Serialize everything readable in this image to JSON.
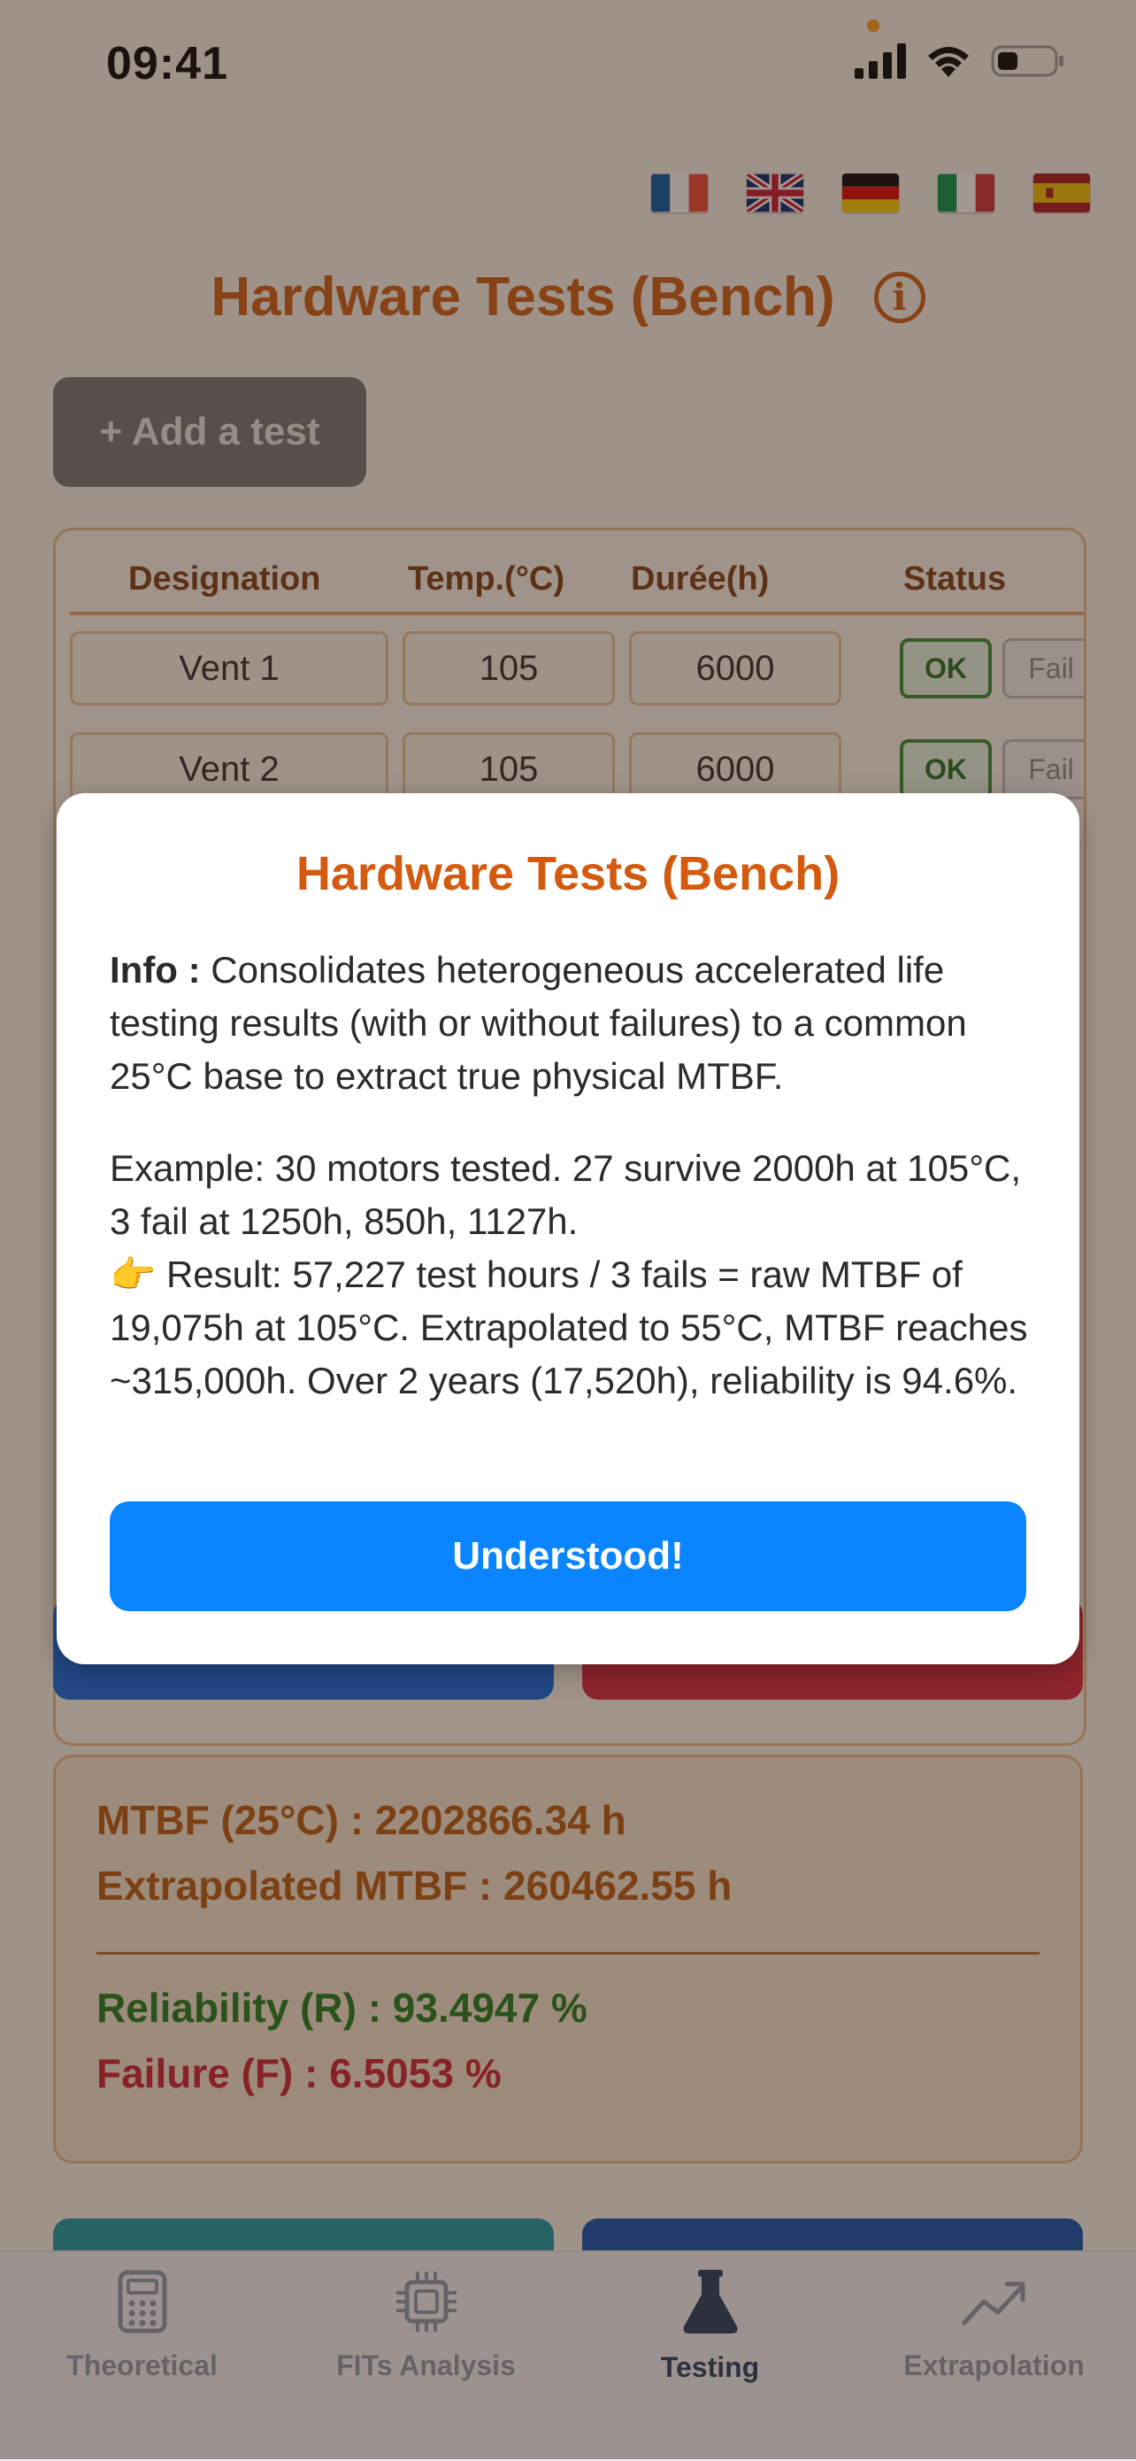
{
  "status_bar": {
    "time": "09:41"
  },
  "page": {
    "title": "Hardware Tests (Bench)",
    "add_button_label": "+ Add a test"
  },
  "table": {
    "headers": [
      "Designation",
      "Temp.(°C)",
      "Durée(h)",
      "Status"
    ],
    "rows": [
      {
        "designation": "Vent 1",
        "temp": "105",
        "duration": "6000",
        "ok_label": "OK",
        "fail_label": "Fail"
      },
      {
        "designation": "Vent 2",
        "temp": "105",
        "duration": "6000",
        "ok_label": "OK",
        "fail_label": "Fail"
      }
    ]
  },
  "results": {
    "mtbf": "MTBF (25°C) : 2202866.34 h",
    "extrapolated": "Extrapolated MTBF : 260462.55 h",
    "reliability": "Reliability (R) : 93.4947 %",
    "failure": "Failure (F) : 6.5053 %"
  },
  "tabs": [
    {
      "label": "Theoretical",
      "icon": "calculator-icon",
      "active": false
    },
    {
      "label": "FITs Analysis",
      "icon": "chip-icon",
      "active": false
    },
    {
      "label": "Testing",
      "icon": "flask-icon",
      "active": true
    },
    {
      "label": "Extrapolation",
      "icon": "trend-up-icon",
      "active": false
    }
  ],
  "languages": [
    "fr",
    "en",
    "de",
    "it",
    "es"
  ],
  "modal": {
    "title": "Hardware Tests (Bench)",
    "info_label": "Info :",
    "info_text": " Consolidates heterogeneous accelerated life testing results (with or without failures) to a common 25°C base to extract true physical MTBF.",
    "example_text": "Example: 30 motors tested. 27 survive 2000h at 105°C, 3 fail at 1250h, 850h, 1127h.",
    "result_emoji": "👉",
    "result_text": " Result: 57,227 test hours / 3 fails = raw MTBF of 19,075h at 105°C. Extrapolated to 55°C, MTBF reaches ~315,000h. Over 2 years (17,520h), reliability is 94.6%.",
    "button_label": "Understood!"
  },
  "colors": {
    "accent": "#cc5a10",
    "primary_blue": "#0a84ff",
    "ok_green": "#2e8b2e",
    "fail_red": "#d9243a"
  }
}
